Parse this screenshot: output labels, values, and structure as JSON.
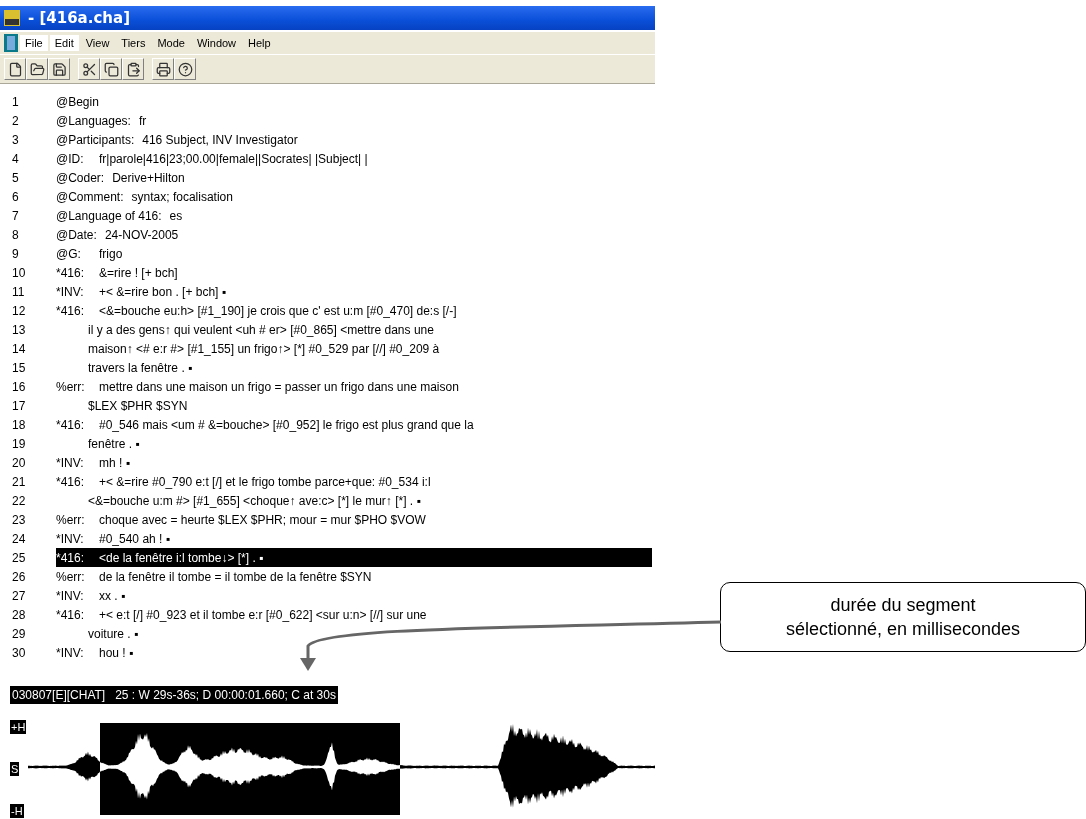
{
  "window": {
    "title": "- [416a.cha]"
  },
  "menu": [
    {
      "label": "File",
      "selected": true
    },
    {
      "label": "Edit",
      "selected": true
    },
    {
      "label": "View",
      "selected": false
    },
    {
      "label": "Tiers",
      "selected": false
    },
    {
      "label": "Mode",
      "selected": false
    },
    {
      "label": "Window",
      "selected": false
    },
    {
      "label": "Help",
      "selected": false
    }
  ],
  "lines": [
    {
      "number": "1",
      "kind": "tier",
      "tier": "@Begin",
      "selected": false
    },
    {
      "number": "2",
      "kind": "tier",
      "tier": "@Languages:",
      "text": "fr",
      "selected": false
    },
    {
      "number": "3",
      "kind": "tier",
      "tier": "@Participants:",
      "text": "416 Subject, INV Investigator",
      "selected": false
    },
    {
      "number": "4",
      "kind": "tier",
      "tier": "@ID:",
      "text": "fr|parole|416|23;00.00|female||Socrates| |Subject| |",
      "selected": false
    },
    {
      "number": "5",
      "kind": "tier",
      "tier": "@Coder:",
      "text": "Derive+Hilton",
      "selected": false
    },
    {
      "number": "6",
      "kind": "tier",
      "tier": "@Comment:",
      "text": "syntax; focalisation",
      "selected": false
    },
    {
      "number": "7",
      "kind": "tier",
      "tier": "@Language of 416:",
      "text": "es",
      "selected": false
    },
    {
      "number": "8",
      "kind": "tier",
      "tier": "@Date:",
      "text": "24-NOV-2005",
      "selected": false
    },
    {
      "number": "9",
      "kind": "tier",
      "tier": "@G:",
      "text": "frigo",
      "selected": false
    },
    {
      "number": "10",
      "kind": "tier",
      "tier": "*416:",
      "text": "&=rire ! [+ bch]",
      "selected": false
    },
    {
      "number": "11",
      "kind": "tier",
      "tier": "*INV:",
      "text": "+< &=rire bon . [+ bch] ▪",
      "selected": false
    },
    {
      "number": "12",
      "kind": "tier",
      "tier": "*416:",
      "text": "<&=bouche eu:h> [#1_190] je crois que c' est u:m [#0_470] de:s [/-]",
      "selected": false
    },
    {
      "number": "13",
      "kind": "continuation",
      "text": "il y a des gens↑ qui veulent <uh # er> [#0_865] <mettre dans une",
      "selected": false
    },
    {
      "number": "14",
      "kind": "continuation",
      "text": "maison↑ <# e:r #> [#1_155] un frigo↑> [*] #0_529 par [//] #0_209 à",
      "selected": false
    },
    {
      "number": "15",
      "kind": "continuation",
      "text": "travers la fenêtre . ▪",
      "selected": false
    },
    {
      "number": "16",
      "kind": "tier",
      "tier": "%err:",
      "text": "mettre dans une maison un frigo = passer un frigo dans une maison",
      "selected": false
    },
    {
      "number": "17",
      "kind": "continuation",
      "text": "$LEX $PHR $SYN",
      "selected": false
    },
    {
      "number": "18",
      "kind": "tier",
      "tier": "*416:",
      "text": "#0_546 mais <um # &=bouche> [#0_952] le frigo est plus grand que la",
      "selected": false
    },
    {
      "number": "19",
      "kind": "continuation",
      "text": "fenêtre . ▪",
      "selected": false
    },
    {
      "number": "20",
      "kind": "tier",
      "tier": "*INV:",
      "text": "mh ! ▪",
      "selected": false
    },
    {
      "number": "21",
      "kind": "tier",
      "tier": "*416:",
      "text": "+< &=rire #0_790 e:t [/] et le frigo tombe parce+que: #0_534 i:l",
      "selected": false
    },
    {
      "number": "22",
      "kind": "continuation",
      "text": "<&=bouche u:m #> [#1_655] <choque↑ ave:c> [*] le mur↑ [*] . ▪",
      "selected": false
    },
    {
      "number": "23",
      "kind": "tier",
      "tier": "%err:",
      "text": "choque avec = heurte $LEX $PHR; mour = mur $PHO $VOW",
      "selected": false
    },
    {
      "number": "24",
      "kind": "tier",
      "tier": "*INV:",
      "text": "#0_540 ah ! ▪",
      "selected": false
    },
    {
      "number": "25",
      "kind": "tier",
      "tier": "*416:",
      "text": "<de la fenêtre i:l tombe↓> [*] . ▪",
      "selected": true
    },
    {
      "number": "26",
      "kind": "tier",
      "tier": "%err:",
      "text": "de la fenêtre il tombe = il tombe de la fenêtre $SYN",
      "selected": false
    },
    {
      "number": "27",
      "kind": "tier",
      "tier": "*INV:",
      "text": "xx . ▪",
      "selected": false
    },
    {
      "number": "28",
      "kind": "tier",
      "tier": "*416:",
      "text": "+< e:t [/] #0_923 et il tombe e:r [#0_622] <sur u:n> [//] sur une",
      "selected": false
    },
    {
      "number": "29",
      "kind": "continuation",
      "text": "voiture . ▪",
      "selected": false
    },
    {
      "number": "30",
      "kind": "tier",
      "tier": "*INV:",
      "text": "hou ! ▪",
      "selected": false
    }
  ],
  "status_bar": "030807[E][CHAT]   25 : W 29s-36s; D 00:00:01.660; C at 30s",
  "waveform": {
    "scale_labels": [
      "+H",
      "S",
      "-H"
    ]
  },
  "callout": {
    "text": "durée du segment\nsélectionné, en millisecondes"
  }
}
